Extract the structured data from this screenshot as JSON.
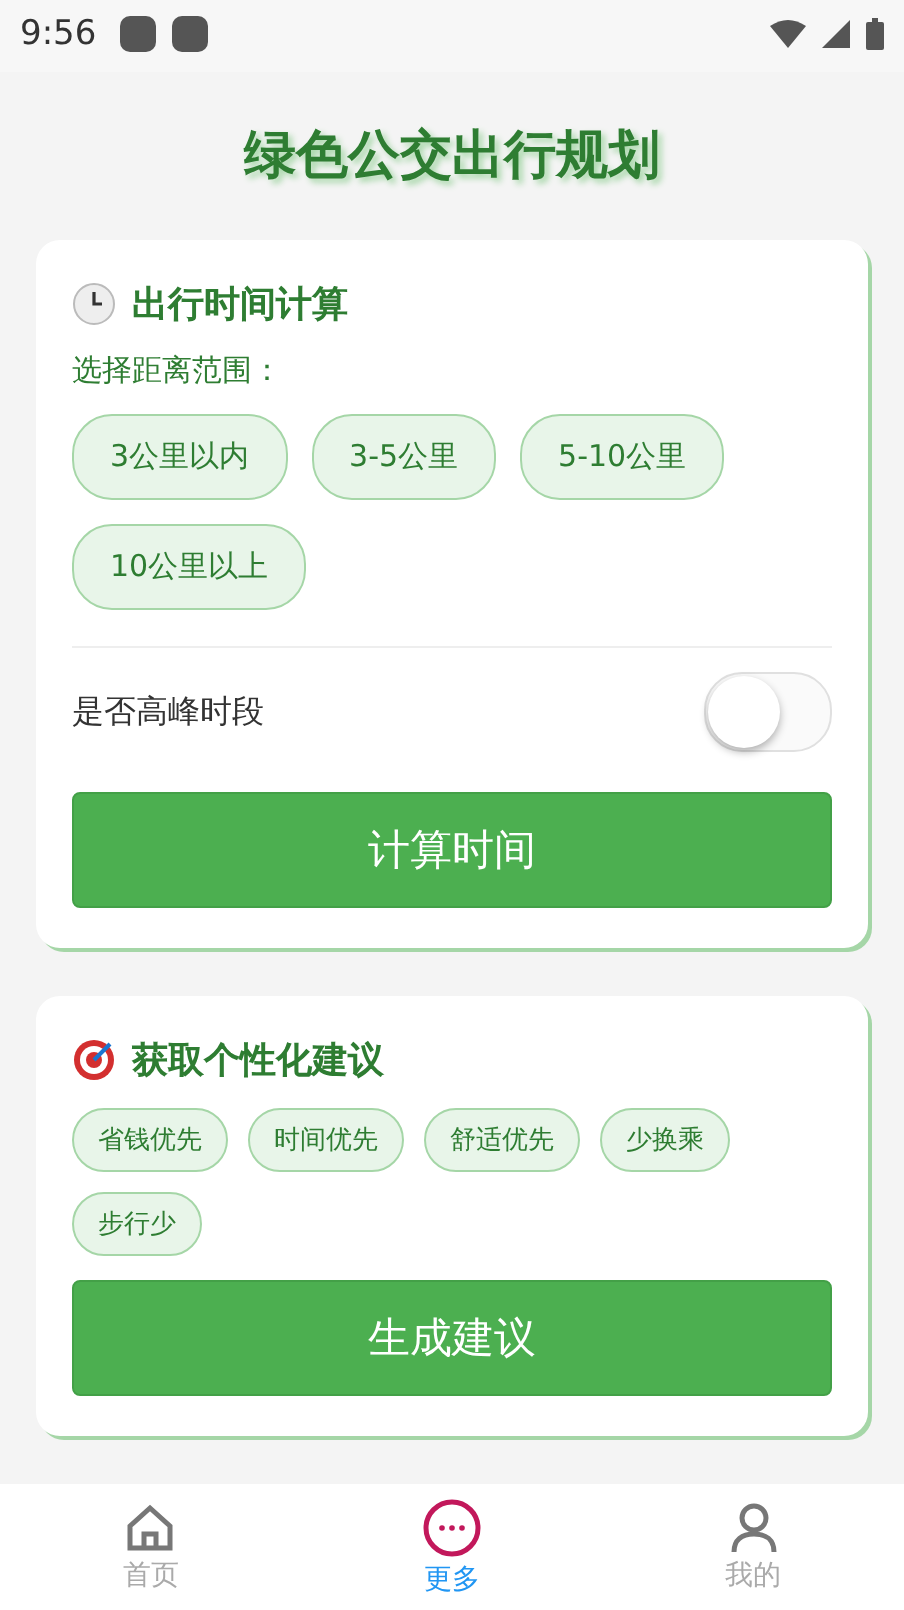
{
  "status_bar": {
    "time": "9:56"
  },
  "title": "绿色公交出行规划",
  "time_card": {
    "heading": "出行时间计算",
    "prompt": "选择距离范围：",
    "distances": [
      {
        "label": "3公里以内",
        "selected": false
      },
      {
        "label": "3-5公里",
        "selected": false
      },
      {
        "label": "5-10公里",
        "selected": false
      },
      {
        "label": "10公里以上",
        "selected": false
      }
    ],
    "peak": {
      "label": "是否高峰时段",
      "on": false
    },
    "button": "计算时间"
  },
  "advice_card": {
    "heading": "获取个性化建议",
    "preferences": [
      {
        "label": "省钱优先",
        "selected": false
      },
      {
        "label": "时间优先",
        "selected": false
      },
      {
        "label": "舒适优先",
        "selected": false
      },
      {
        "label": "少换乘",
        "selected": false
      },
      {
        "label": "步行少",
        "selected": false
      }
    ],
    "button": "生成建议"
  },
  "bottom_nav": [
    {
      "label": "首页",
      "kind": "home",
      "selected": false
    },
    {
      "label": "更多",
      "kind": "more",
      "selected": true
    },
    {
      "label": "我的",
      "kind": "profile",
      "selected": false
    }
  ]
}
